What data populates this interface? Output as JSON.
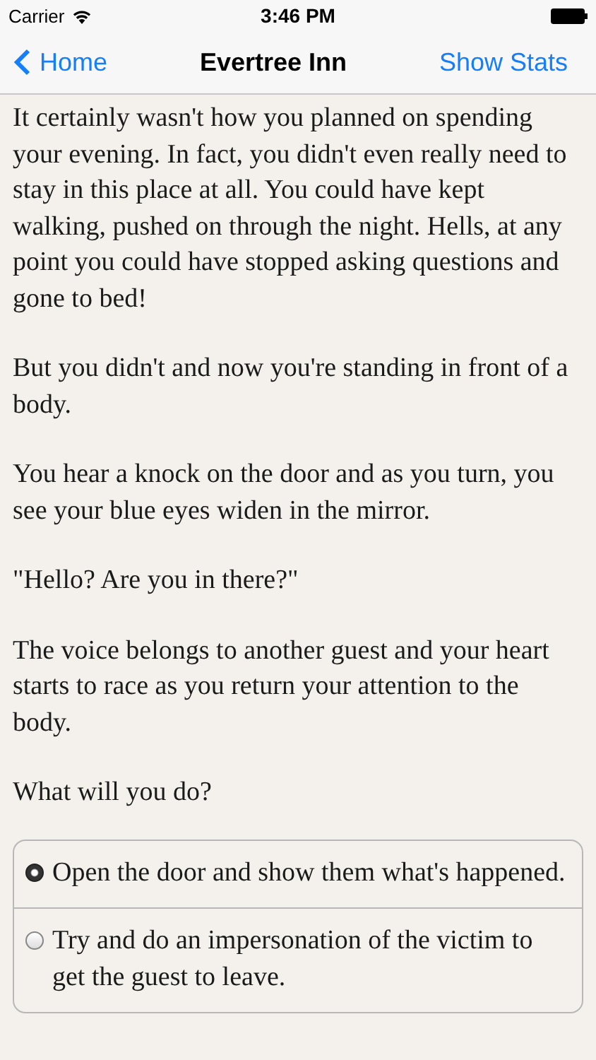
{
  "status_bar": {
    "carrier": "Carrier",
    "time": "3:46 PM"
  },
  "nav": {
    "back": "Home",
    "title": "Evertree Inn",
    "action": "Show Stats"
  },
  "paragraphs": [
    "It certainly wasn't how you planned on spending your evening. In fact, you didn't even really need to stay in this place at all. You could have kept walking, pushed on through the night. Hells, at any point you could have stopped asking questions and gone to bed!",
    "But you didn't and now you're standing in front of a body.",
    "You hear a knock on the door and as you turn, you see your blue eyes widen in the mirror.",
    "\"Hello? Are you in there?\"",
    "The voice belongs to another guest and your heart starts to race as you return your attention to the body.",
    "What will you do?"
  ],
  "choices": [
    {
      "text": "Open the door and show them what's happened.",
      "selected": true
    },
    {
      "text": "Try and do an impersonation of the victim to get the guest to leave.",
      "selected": false
    }
  ]
}
